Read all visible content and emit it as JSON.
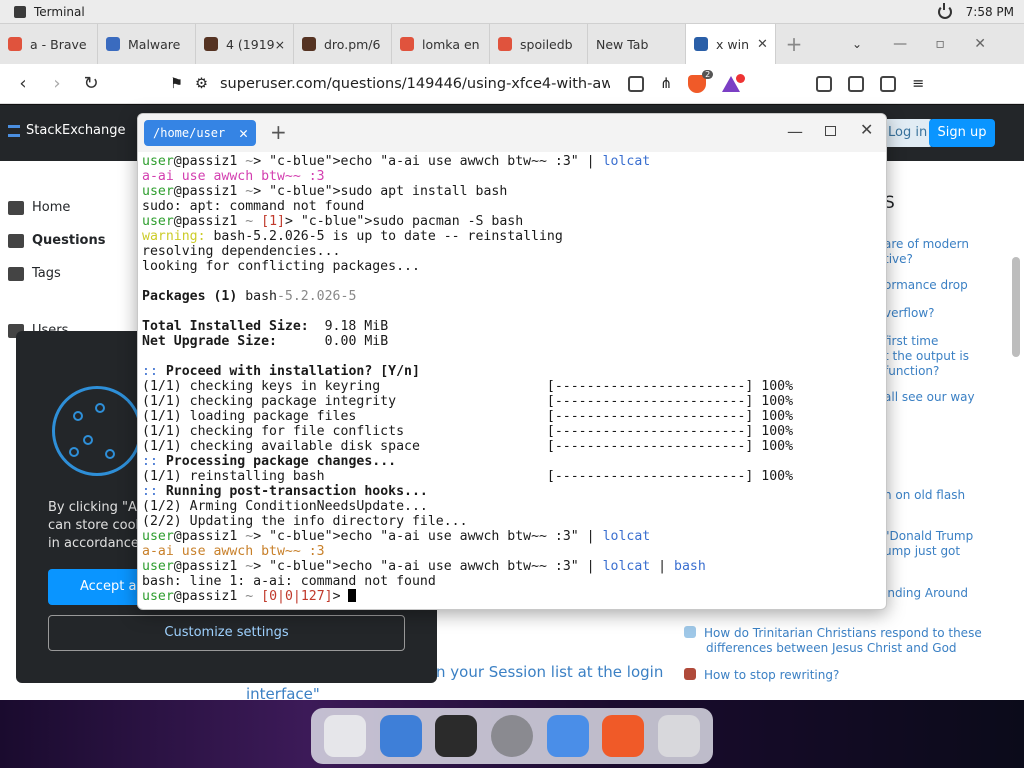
{
  "system": {
    "app_title": "Terminal",
    "time": "7:58 PM"
  },
  "browser": {
    "tabs": [
      {
        "label": "a - Brave",
        "color": "#e0533d"
      },
      {
        "label": "Malware",
        "color": "#3a6bbf"
      },
      {
        "label": "4 (1919×",
        "color": "#553322"
      },
      {
        "label": "dro.pm/6",
        "color": "#553322"
      },
      {
        "label": "lomka en",
        "color": "#e0533d"
      },
      {
        "label": "spoiledb",
        "color": "#e0533d"
      },
      {
        "label": "New Tab",
        "color": ""
      },
      {
        "label": "x win",
        "color": "#2a5fa8"
      }
    ],
    "url": "superuser.com/questions/149446/using-xfce4-with-awesome",
    "shield_count": "2"
  },
  "stackexchange": {
    "logo": "StackExchange",
    "login": "Log in",
    "signup": "Sign up",
    "nav": [
      "Home",
      "Questions",
      "Tags",
      "Users"
    ],
    "right_heading": "S",
    "right_links": [
      "are of modern",
      "tive?",
      "ormance drop",
      "verflow?",
      "first time",
      "t the output is",
      "function?",
      "all see our way",
      "n on old flash",
      "\"Donald Trump",
      "ump just got",
      "inding Around"
    ],
    "hot_questions": [
      "How do Trinitarian Christians respond to these",
      "differences between Jesus Christ and God",
      "How to stop rewriting?"
    ],
    "session_link": "n your Session list at the login",
    "session_link2": "interface\""
  },
  "cookie": {
    "text": "By clicking \"Acc can store cook in accordance",
    "text_lines": [
      "By clicking \"Acc",
      "can store cook",
      "in accordance"
    ],
    "accept": "Accept al",
    "customize": "Customize settings"
  },
  "terminal": {
    "tab_title": "/home/user",
    "lines": [
      "user@passiz1 ~> echo \"a-ai use awwch btw~~ :3\" | lolcat",
      "a-ai use awwch btw~~ :3",
      "user@passiz1 ~> sudo apt install bash",
      "sudo: apt: command not found",
      "user@passiz1 ~ [1]> sudo pacman -S bash",
      "warning: bash-5.2.026-5 is up to date -- reinstalling",
      "resolving dependencies...",
      "looking for conflicting packages...",
      "",
      "Packages (1) bash-5.2.026-5",
      "",
      "Total Installed Size:  9.18 MiB",
      "Net Upgrade Size:      0.00 MiB",
      "",
      ":: Proceed with installation? [Y/n]",
      "(1/1) checking keys in keyring                     [------------------------] 100%",
      "(1/1) checking package integrity                   [------------------------] 100%",
      "(1/1) loading package files                        [------------------------] 100%",
      "(1/1) checking for file conflicts                  [------------------------] 100%",
      "(1/1) checking available disk space                [------------------------] 100%",
      ":: Processing package changes...",
      "(1/1) reinstalling bash                            [------------------------] 100%",
      ":: Running post-transaction hooks...",
      "(1/2) Arming ConditionNeedsUpdate...",
      "(2/2) Updating the info directory file...",
      "user@passiz1 ~> echo \"a-ai use awwch btw~~ :3\" | lolcat",
      "a-ai use awwch btw~~ :3",
      "user@passiz1 ~> echo \"a-ai use awwch btw~~ :3\" | lolcat | bash",
      "bash: line 1: a-ai: command not found",
      "user@passiz1 ~ [0|0|127]> "
    ]
  },
  "dock": [
    "launcher-icon",
    "files-icon",
    "terminal-icon",
    "settings-icon",
    "calculator-icon",
    "brave-icon",
    "trash-icon"
  ]
}
